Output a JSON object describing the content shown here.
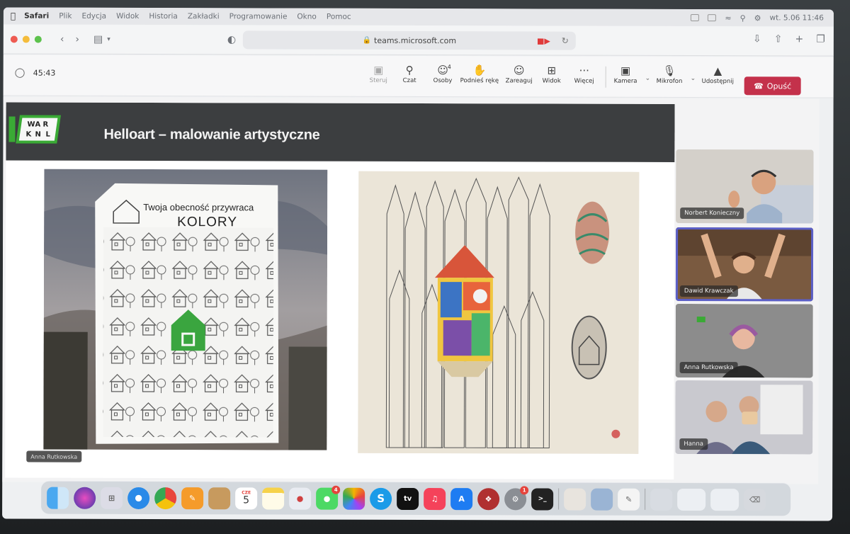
{
  "menubar": {
    "app_name": "Safari",
    "items": [
      "Plik",
      "Edycja",
      "Widok",
      "Historia",
      "Zakładki",
      "Programowanie",
      "Okno",
      "Pomoc"
    ],
    "clock": "wt. 5.06 11:46"
  },
  "browser": {
    "url": "teams.microsoft.com"
  },
  "teams": {
    "timer": "45:43",
    "buttons": {
      "steruj": "Steruj",
      "czat": "Czat",
      "osoby": "Osoby",
      "osoby_count": "4",
      "podnies": "Podnieś rękę",
      "zareaguj": "Zareaguj",
      "widok": "Widok",
      "wiecej": "Więcej",
      "kamera": "Kamera",
      "mikrofon": "Mikrofon",
      "udostepnij": "Udostępnij",
      "opusc": "Opuść"
    }
  },
  "slide": {
    "logo_letters": [
      "W",
      "A",
      "R",
      "K",
      "N",
      "L"
    ],
    "title": "Helloart – malowanie artystyczne",
    "mural_line1": "Twoja obecność przywraca",
    "mural_line2": "KOLORY"
  },
  "presenter_label": "Anna Rutkowska",
  "participants": [
    {
      "name": "Norbert Konieczny"
    },
    {
      "name": "Dawid Krawczak"
    },
    {
      "name": "Anna Rutkowska"
    },
    {
      "name": "Hanna"
    }
  ],
  "dock": {
    "calendar_day": "5",
    "calendar_month": "CZE",
    "messages_badge": "4",
    "settings_badge": "1",
    "skype_letter": "S",
    "tv_label": "tv"
  },
  "colors": {
    "teams_accent": "#5b5fc7",
    "leave_red": "#c4314b",
    "slide_header": "#3c3e40",
    "logo_green": "#3aaa35"
  }
}
